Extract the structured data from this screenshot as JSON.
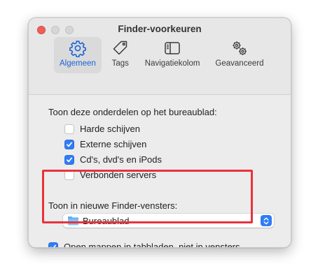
{
  "window": {
    "title": "Finder-voorkeuren"
  },
  "toolbar": {
    "tabs": [
      {
        "label": "Algemeen",
        "icon": "gear-icon",
        "active": true
      },
      {
        "label": "Tags",
        "icon": "tag-icon",
        "active": false
      },
      {
        "label": "Navigatiekolom",
        "icon": "sidebar-icon",
        "active": false
      },
      {
        "label": "Geavanceerd",
        "icon": "gears-icon",
        "active": false
      }
    ]
  },
  "desktop_section": {
    "label": "Toon deze onderdelen op het bureaublad:",
    "items": [
      {
        "label": "Harde schijven",
        "checked": false
      },
      {
        "label": "Externe schijven",
        "checked": true
      },
      {
        "label": "Cd's, dvd's en iPods",
        "checked": true
      },
      {
        "label": "Verbonden servers",
        "checked": false
      }
    ]
  },
  "new_window": {
    "label": "Toon in nieuwe Finder-vensters:",
    "selected": "Bureaublad",
    "icon": "folder-icon"
  },
  "tabs_option": {
    "label": "Open mappen in tabbladen, niet in vensters",
    "checked": true
  },
  "colors": {
    "accent": "#2f7cf6",
    "highlight": "#e8323e"
  }
}
